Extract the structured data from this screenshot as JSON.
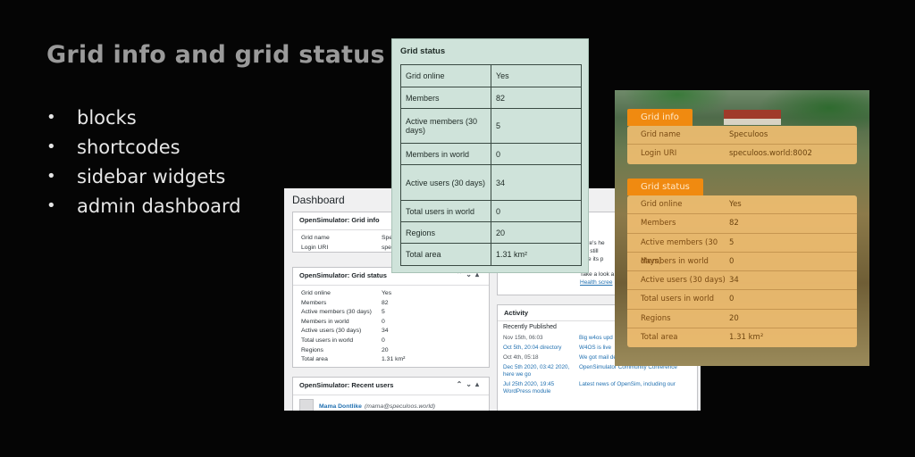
{
  "slide": {
    "title": "Grid info and grid status",
    "bullets": [
      "blocks",
      "shortcodes",
      "sidebar widgets",
      "admin dashboard"
    ]
  },
  "dashboard": {
    "title": "Dashboard",
    "grid_info": {
      "header": "OpenSimulator: Grid info",
      "rows": [
        {
          "k": "Grid name",
          "v": "Spec"
        },
        {
          "k": "Login URI",
          "v": "spec"
        }
      ]
    },
    "grid_status": {
      "header": "OpenSimulator: Grid status",
      "rows": [
        {
          "k": "Grid online",
          "v": "Yes"
        },
        {
          "k": "Members",
          "v": "82"
        },
        {
          "k": "Active members (30 days)",
          "v": "5"
        },
        {
          "k": "Members in world",
          "v": "0"
        },
        {
          "k": "Active users (30 days)",
          "v": "34"
        },
        {
          "k": "Total users in world",
          "v": "0"
        },
        {
          "k": "Regions",
          "v": "20"
        },
        {
          "k": "Total area",
          "v": "1.31 km²"
        }
      ]
    },
    "recent_users": {
      "header": "OpenSimulator: Recent users",
      "user_name": "Mama Dontlike",
      "user_email": "(mama@speculoos.world)"
    },
    "health": {
      "lines": [
        "r site's he",
        "are still",
        "rove its p"
      ],
      "take_look": "Take a look a",
      "link": "Health scree"
    },
    "activity": {
      "header": "Activity",
      "subheader": "Recently Published",
      "rows": [
        {
          "d": "Nov 15th, 06:03",
          "t": "Big w4os upd"
        },
        {
          "d": "Oct 5th, 20:04 directory",
          "t": "W4OS is live"
        },
        {
          "d": "Oct 4th, 05:18",
          "t": "We got mail delivery issues (oops!)"
        },
        {
          "d": "Dec 5th 2020, 03:42 2020, here we go",
          "t": "OpenSimulator Community Conference"
        },
        {
          "d": "Jul 25th 2020, 19:45 WordPress module",
          "t": "Latest news of OpenSim, including our"
        }
      ]
    }
  },
  "grid_status_card": {
    "title": "Grid status",
    "rows": [
      {
        "k": "Grid online",
        "v": "Yes"
      },
      {
        "k": "Members",
        "v": "82"
      },
      {
        "k": "Active members (30 days)",
        "v": "5"
      },
      {
        "k": "Members in world",
        "v": "0"
      },
      {
        "k": "Active users (30 days)",
        "v": "34"
      },
      {
        "k": "Total users in world",
        "v": "0"
      },
      {
        "k": "Regions",
        "v": "20"
      },
      {
        "k": "Total area",
        "v": "1.31 km²"
      }
    ]
  },
  "theme_card": {
    "info_tab": "Grid info",
    "info_rows": [
      {
        "k": "Grid name",
        "v": "Speculoos"
      },
      {
        "k": "Login URI",
        "v": "speculoos.world:8002"
      }
    ],
    "status_tab": "Grid status",
    "status_rows": [
      {
        "k": "Grid online",
        "v": "Yes"
      },
      {
        "k": "Members",
        "v": "82"
      },
      {
        "k": "Active members (30 days)",
        "v": "5"
      },
      {
        "k": "Members in world",
        "v": "0"
      },
      {
        "k": "Active users (30 days)",
        "v": "34"
      },
      {
        "k": "Total users in world",
        "v": "0"
      },
      {
        "k": "Regions",
        "v": "20"
      },
      {
        "k": "Total area",
        "v": "1.31 km²"
      }
    ]
  },
  "colors": {
    "background": "#050505",
    "accent_orange": "#f08a10",
    "card_green": "#cfe3da",
    "wp_link": "#2271b1"
  }
}
